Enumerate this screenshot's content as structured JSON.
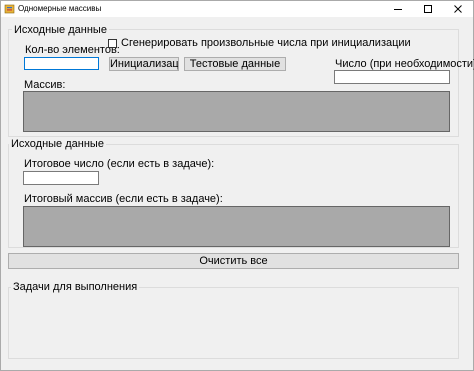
{
  "window": {
    "title": "Одномерные массивы"
  },
  "group1": {
    "legend": "Исходные данные",
    "count_label": "Кол-во элементов:",
    "count_value": "",
    "checkbox_label": "Сгенерировать произвольные числа при инициализации",
    "checkbox_checked": false,
    "init_button": "Инициализаци",
    "test_button": "Тестовые данные",
    "number_label": "Число (при необходимости):",
    "number_value": "",
    "array_label": "Массив:"
  },
  "group2": {
    "legend": "Исходные данные",
    "result_number_label": "Итоговое число (если есть в задаче):",
    "result_number_value": "",
    "result_array_label": "Итоговый массив (если есть в задаче):"
  },
  "clear_button": "Очистить все",
  "group3": {
    "legend": "Задачи для выполнения"
  }
}
